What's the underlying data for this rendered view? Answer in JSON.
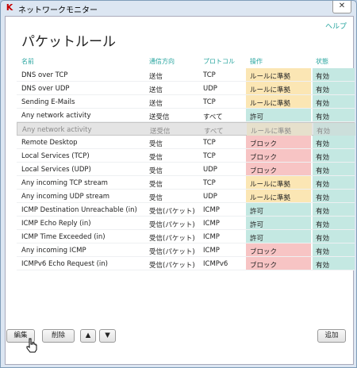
{
  "window": {
    "title": "ネットワークモニター",
    "close_glyph": "✕",
    "app_icon_glyph": "K"
  },
  "help_link": "ヘルプ",
  "page_title": "パケットルール",
  "columns": {
    "name": "名前",
    "direction": "通信方向",
    "protocol": "プロトコル",
    "action": "操作",
    "status": "状態"
  },
  "rows": [
    {
      "name": "DNS over TCP",
      "direction": "送信",
      "protocol": "TCP",
      "action": "ルールに準拠",
      "action_type": "warn",
      "status": "有効"
    },
    {
      "name": "DNS over UDP",
      "direction": "送信",
      "protocol": "UDP",
      "action": "ルールに準拠",
      "action_type": "warn",
      "status": "有効"
    },
    {
      "name": "Sending E-Mails",
      "direction": "送信",
      "protocol": "TCP",
      "action": "ルールに準拠",
      "action_type": "warn",
      "status": "有効"
    },
    {
      "name": "Any network activity",
      "direction": "送受信",
      "protocol": "すべて",
      "action": "許可",
      "action_type": "allow",
      "status": "有効"
    },
    {
      "name": "Any network activity",
      "direction": "送受信",
      "protocol": "すべて",
      "action": "ルールに準拠",
      "action_type": "warn",
      "status": "有効",
      "selected": true
    },
    {
      "name": "Remote Desktop",
      "direction": "受信",
      "protocol": "TCP",
      "action": "ブロック",
      "action_type": "block",
      "status": "有効"
    },
    {
      "name": "Local Services (TCP)",
      "direction": "受信",
      "protocol": "TCP",
      "action": "ブロック",
      "action_type": "block",
      "status": "有効"
    },
    {
      "name": "Local Services (UDP)",
      "direction": "受信",
      "protocol": "UDP",
      "action": "ブロック",
      "action_type": "block",
      "status": "有効"
    },
    {
      "name": "Any incoming TCP stream",
      "direction": "受信",
      "protocol": "TCP",
      "action": "ルールに準拠",
      "action_type": "warn",
      "status": "有効"
    },
    {
      "name": "Any incoming UDP stream",
      "direction": "受信",
      "protocol": "UDP",
      "action": "ルールに準拠",
      "action_type": "warn",
      "status": "有効"
    },
    {
      "name": "ICMP Destination Unreachable (in)",
      "direction": "受信(パケット)",
      "protocol": "ICMP",
      "action": "許可",
      "action_type": "allow",
      "status": "有効"
    },
    {
      "name": "ICMP Echo Reply (in)",
      "direction": "受信(パケット)",
      "protocol": "ICMP",
      "action": "許可",
      "action_type": "allow",
      "status": "有効"
    },
    {
      "name": "ICMP Time Exceeded (in)",
      "direction": "受信(パケット)",
      "protocol": "ICMP",
      "action": "許可",
      "action_type": "allow",
      "status": "有効"
    },
    {
      "name": "Any incoming ICMP",
      "direction": "受信(パケット)",
      "protocol": "ICMP",
      "action": "ブロック",
      "action_type": "block",
      "status": "有効"
    },
    {
      "name": "ICMPv6 Echo Request (in)",
      "direction": "受信(パケット)",
      "protocol": "ICMPv6",
      "action": "ブロック",
      "action_type": "block",
      "status": "有効"
    }
  ],
  "buttons": {
    "edit": "編集",
    "delete": "削除",
    "up_glyph": "▲",
    "down_glyph": "▼",
    "add": "追加"
  },
  "colors": {
    "accent": "#2aa6a0",
    "warn": "#fbe6b4",
    "allow": "#c4e8e2",
    "block": "#f7c4c4"
  }
}
